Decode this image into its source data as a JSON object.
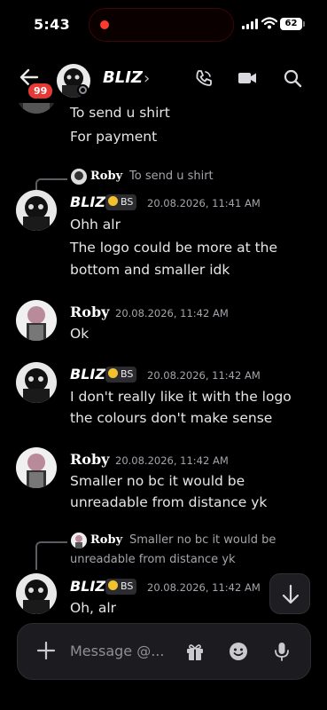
{
  "status_bar": {
    "time": "5:43",
    "battery": "62"
  },
  "header": {
    "unread_badge": "99",
    "title": "BLIZ",
    "chevron": "›"
  },
  "messages": {
    "prev_tail": [
      "To send u shirt",
      "For payment"
    ],
    "m1": {
      "reply_author": "Roby",
      "reply_text": "To send u shirt",
      "author": "BLIZ",
      "role": "BS",
      "time": "20.08.2026, 11:41 AM",
      "lines": [
        "Ohh alr",
        "The logo could be more at the",
        "bottom and smaller idk"
      ]
    },
    "m2": {
      "author": "Roby",
      "time": "20.08.2026, 11:42 AM",
      "lines": [
        "Ok"
      ]
    },
    "m3": {
      "author": "BLIZ",
      "role": "BS",
      "time": "20.08.2026, 11:42 AM",
      "lines": [
        "I don't really like it with the logo",
        "the colours don't make sense"
      ]
    },
    "m4": {
      "author": "Roby",
      "time": "20.08.2026, 11:42 AM",
      "lines": [
        "Smaller no bc it would be",
        "unreadable from distance yk"
      ]
    },
    "m5": {
      "reply_author": "Roby",
      "reply_text_1": "Smaller no bc it would be",
      "reply_text_2": "unreadable from distance yk",
      "author": "BLIZ",
      "role": "BS",
      "time": "20.08.2026, 11:42 AM",
      "lines": [
        "Oh, alr"
      ]
    }
  },
  "composer": {
    "placeholder": "Message @..."
  },
  "colors": {
    "background": "#000000",
    "badge": "#e53935",
    "role_icon": "#f2c12e",
    "muted_text": "#a4a4ab"
  },
  "icons": [
    "back-arrow-icon",
    "call-icon",
    "video-icon",
    "search-icon",
    "plus-icon",
    "gift-icon",
    "emoji-icon",
    "mic-icon",
    "arrow-down-icon"
  ]
}
